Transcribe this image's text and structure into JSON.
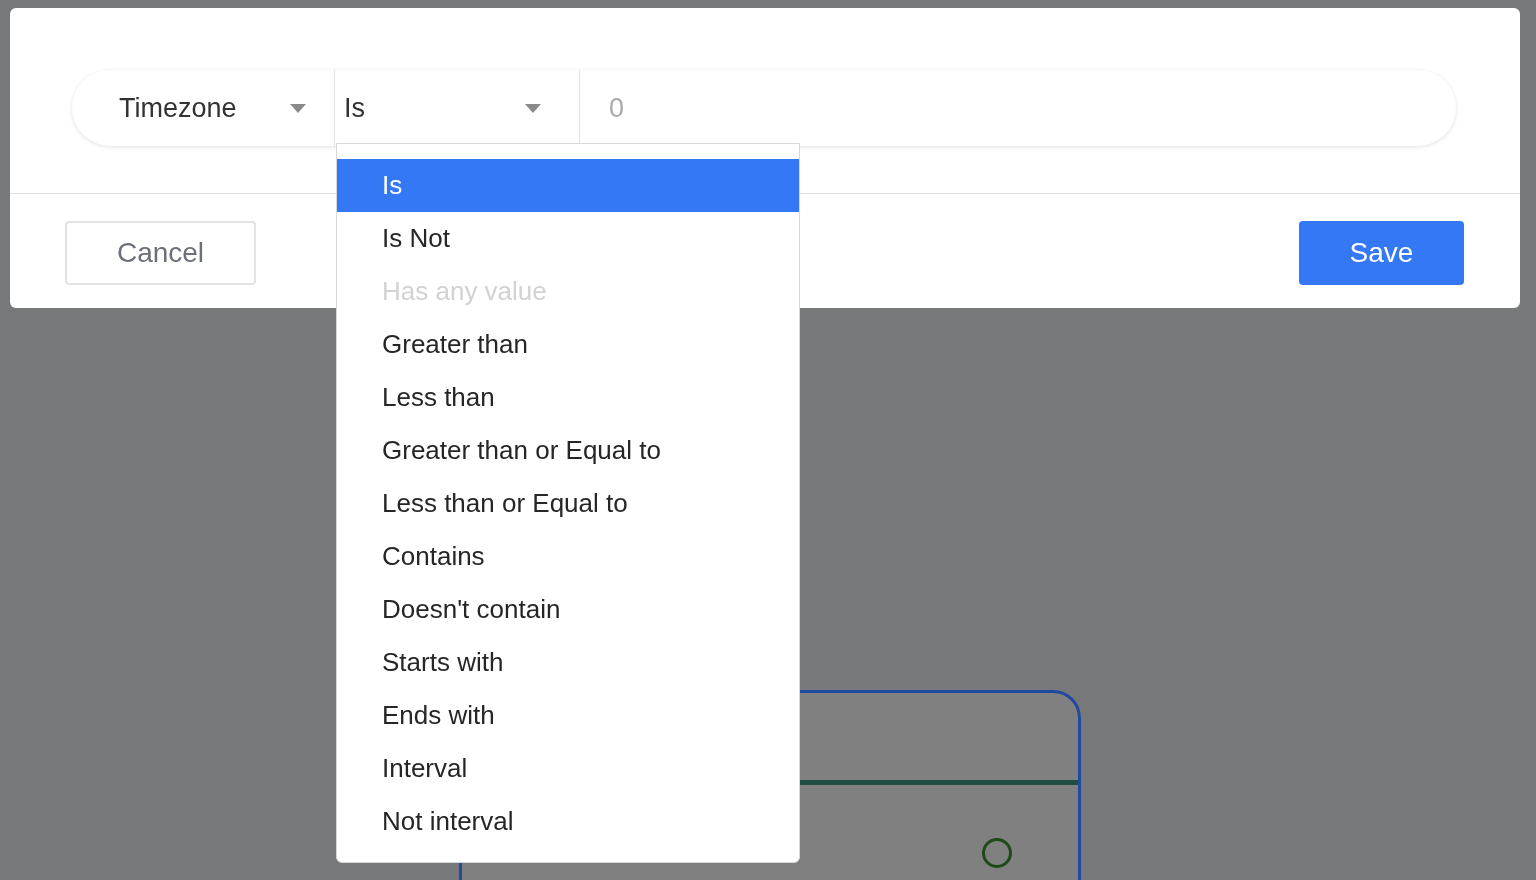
{
  "filter": {
    "field": {
      "value": "Timezone"
    },
    "operator": {
      "value": "Is",
      "expanded": true
    },
    "value_field": {
      "placeholder": "0"
    }
  },
  "operator_options": [
    {
      "label": "Is",
      "selected": true,
      "disabled": false
    },
    {
      "label": "Is Not",
      "selected": false,
      "disabled": false
    },
    {
      "label": "Has any value",
      "selected": false,
      "disabled": true
    },
    {
      "label": "Greater than",
      "selected": false,
      "disabled": false
    },
    {
      "label": "Less than",
      "selected": false,
      "disabled": false
    },
    {
      "label": "Greater than or Equal to",
      "selected": false,
      "disabled": false
    },
    {
      "label": "Less than or Equal to",
      "selected": false,
      "disabled": false
    },
    {
      "label": "Contains",
      "selected": false,
      "disabled": false
    },
    {
      "label": "Doesn't contain",
      "selected": false,
      "disabled": false
    },
    {
      "label": "Starts with",
      "selected": false,
      "disabled": false
    },
    {
      "label": "Ends with",
      "selected": false,
      "disabled": false
    },
    {
      "label": "Interval",
      "selected": false,
      "disabled": false
    },
    {
      "label": "Not interval",
      "selected": false,
      "disabled": false
    }
  ],
  "buttons": {
    "cancel": "Cancel",
    "save": "Save"
  }
}
